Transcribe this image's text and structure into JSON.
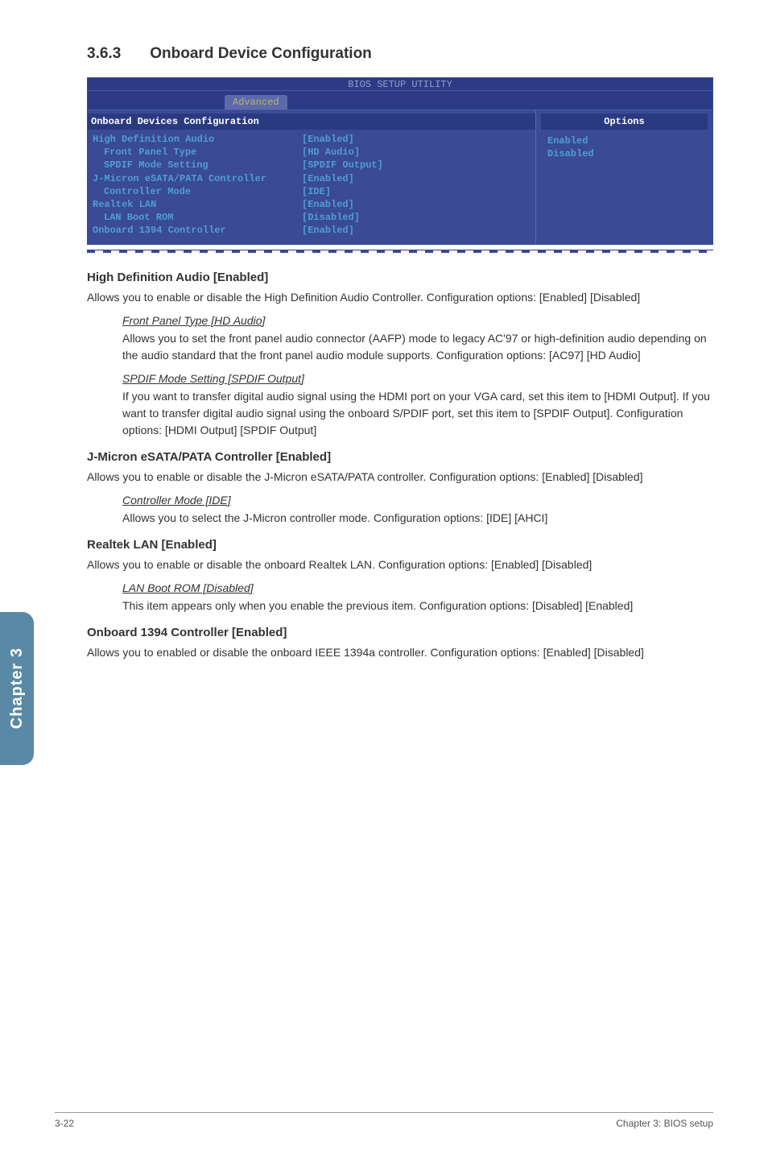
{
  "heading": {
    "num": "3.6.3",
    "title": "Onboard Device Configuration"
  },
  "bios": {
    "title": "BIOS SETUP UTILITY",
    "tab": "Advanced",
    "config_header": "Onboard Devices Configuration",
    "options_header": "Options",
    "rows": [
      {
        "label": "High Definition Audio",
        "value": "[Enabled]",
        "indent": false
      },
      {
        "label": "Front Panel Type",
        "value": "[HD Audio]",
        "indent": true
      },
      {
        "label": "SPDIF Mode Setting",
        "value": "[SPDIF Output]",
        "indent": true
      },
      {
        "label": "J-Micron eSATA/PATA Controller",
        "value": "[Enabled]",
        "indent": false
      },
      {
        "label": "Controller Mode",
        "value": "[IDE]",
        "indent": true
      },
      {
        "label": "Realtek LAN",
        "value": "[Enabled]",
        "indent": false
      },
      {
        "label": "LAN Boot ROM",
        "value": "[Disabled]",
        "indent": true
      },
      {
        "label": "Onboard 1394 Controller",
        "value": "[Enabled]",
        "indent": false
      }
    ],
    "options": [
      "Enabled",
      "Disabled"
    ]
  },
  "s1": {
    "h": "High Definition Audio [Enabled]",
    "p": "Allows you to enable or disable the High Definition Audio Controller. Configuration options: [Enabled] [Disabled]",
    "sub1_h": "Front Panel Type [HD Audio]",
    "sub1_p": "Allows you to set the front panel audio connector (AAFP) mode to legacy AC'97 or high-definition audio depending on the audio standard that the front panel audio module supports. Configuration options: [AC97] [HD Audio]",
    "sub2_h": "SPDIF Mode Setting [SPDIF Output]",
    "sub2_p": "If you want to transfer digital audio signal using the HDMI port on your VGA card, set this item to [HDMI Output]. If you want to transfer digital audio signal using the onboard S/PDIF port, set this item to [SPDIF Output]. Configuration options: [HDMI Output] [SPDIF Output]"
  },
  "s2": {
    "h": "J-Micron eSATA/PATA Controller [Enabled]",
    "p": "Allows you to enable or disable the J-Micron eSATA/PATA controller. Configuration options: [Enabled] [Disabled]",
    "sub1_h": "Controller Mode [IDE]",
    "sub1_p": "Allows you to select the J-Micron controller mode. Configuration options: [IDE] [AHCI]"
  },
  "s3": {
    "h": "Realtek LAN [Enabled]",
    "p": "Allows you to enable or disable the onboard Realtek LAN. Configuration options: [Enabled] [Disabled]",
    "sub1_h": "LAN Boot ROM [Disabled]",
    "sub1_p": "This item appears only when you enable the previous item. Configuration options: [Disabled] [Enabled]"
  },
  "s4": {
    "h": "Onboard 1394 Controller [Enabled]",
    "p": "Allows you to enabled or disable the onboard IEEE 1394a controller. Configuration options: [Enabled] [Disabled]"
  },
  "sidetab": "Chapter 3",
  "footer": {
    "left": "3-22",
    "right": "Chapter 3: BIOS setup"
  }
}
